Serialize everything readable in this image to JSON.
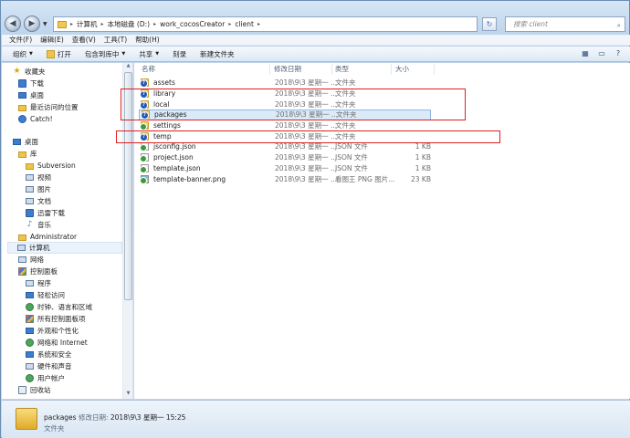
{
  "address": {
    "crumbs": [
      "计算机",
      "本地磁盘 (D:)",
      "work_cocosCreator",
      "client"
    ],
    "search_placeholder": "搜索 client"
  },
  "menu": [
    "文件(F)",
    "编辑(E)",
    "查看(V)",
    "工具(T)",
    "帮助(H)"
  ],
  "toolbar": {
    "organize": "组织",
    "open": "打开",
    "include_library": "包含到库中",
    "share": "共享",
    "burn": "刻录",
    "new_folder": "新建文件夹"
  },
  "nav": {
    "favorites": "收藏夹",
    "downloads": "下载",
    "desktop_fav": "桌面",
    "recent": "最近访问的位置",
    "catch": "Catch!",
    "desktop": "桌面",
    "libraries": "库",
    "subversion": "Subversion",
    "videos": "视频",
    "pictures": "图片",
    "documents": "文档",
    "thunder": "迅雷下载",
    "music": "音乐",
    "admin": "Administrator",
    "computer": "计算机",
    "network": "网络",
    "control_panel": "控制面板",
    "programs": "程序",
    "ease": "轻松访问",
    "clock": "时钟、语言和区域",
    "all_cp": "所有控制面板项",
    "appearance": "外观和个性化",
    "net_internet": "网络和 Internet",
    "system": "系统和安全",
    "hardware": "硬件和声音",
    "accounts": "用户帐户",
    "recycle": "回收站"
  },
  "columns": {
    "name": "名称",
    "date": "修改日期",
    "type": "类型",
    "size": "大小"
  },
  "files": [
    {
      "name": "assets",
      "date": "2018\\9\\3 星期一 ...",
      "type": "文件夹",
      "size": "",
      "kind": "folder",
      "status": "q"
    },
    {
      "name": "library",
      "date": "2018\\9\\3 星期一 ...",
      "type": "文件夹",
      "size": "",
      "kind": "folder",
      "status": "q"
    },
    {
      "name": "local",
      "date": "2018\\9\\3 星期一 ...",
      "type": "文件夹",
      "size": "",
      "kind": "folder",
      "status": "q"
    },
    {
      "name": "packages",
      "date": "2018\\9\\3 星期一 ...",
      "type": "文件夹",
      "size": "",
      "kind": "folder",
      "status": "q"
    },
    {
      "name": "settings",
      "date": "2018\\9\\3 星期一 ...",
      "type": "文件夹",
      "size": "",
      "kind": "folder",
      "status": "ok"
    },
    {
      "name": "temp",
      "date": "2018\\9\\3 星期一 ...",
      "type": "文件夹",
      "size": "",
      "kind": "folder",
      "status": "q"
    },
    {
      "name": "jsconfig.json",
      "date": "2018\\9\\3 星期一 ...",
      "type": "JSON 文件",
      "size": "1 KB",
      "kind": "file",
      "status": "ok"
    },
    {
      "name": "project.json",
      "date": "2018\\9\\3 星期一 ...",
      "type": "JSON 文件",
      "size": "1 KB",
      "kind": "file",
      "status": "ok"
    },
    {
      "name": "template.json",
      "date": "2018\\9\\3 星期一 ...",
      "type": "JSON 文件",
      "size": "1 KB",
      "kind": "file",
      "status": "ok"
    },
    {
      "name": "template-banner.png",
      "date": "2018\\9\\3 星期一 ...",
      "type": "看图王 PNG 图片...",
      "size": "23 KB",
      "kind": "img",
      "status": "ok"
    }
  ],
  "details": {
    "name": "packages",
    "date_label": "修改日期:",
    "date_value": "2018\\9\\3 星期一 15:25",
    "type": "文件夹"
  },
  "colors": {
    "highlight": "#e01e1e",
    "selection": "#dbeaf9"
  }
}
